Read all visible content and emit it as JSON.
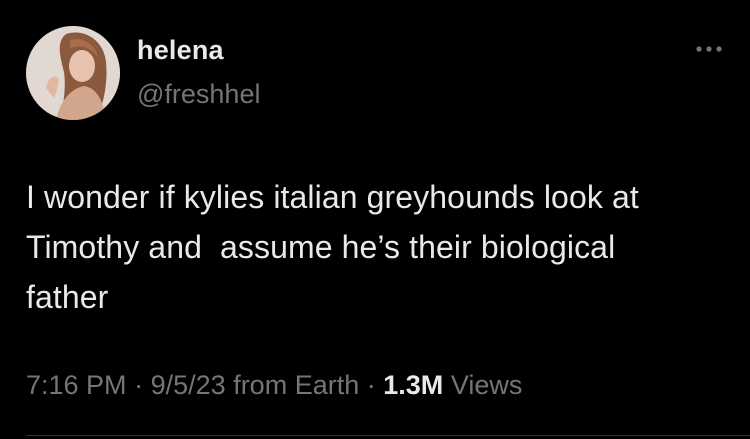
{
  "user": {
    "display_name": "helena",
    "handle": "@freshhel"
  },
  "menu": {
    "icon": "more-horizontal-icon"
  },
  "tweet": {
    "text": "I wonder if kylies italian greyhounds look at\nTimothy and  assume he’s their biological\nfather",
    "time": "7:16 PM",
    "separator": "·",
    "date": "9/5/23",
    "source": "from Earth",
    "views_count": "1.3M",
    "views_label": "Views"
  },
  "colors": {
    "background": "#000000",
    "primary_text": "#e7e9ea",
    "secondary_text": "#71767b",
    "divider": "#2f3336"
  }
}
